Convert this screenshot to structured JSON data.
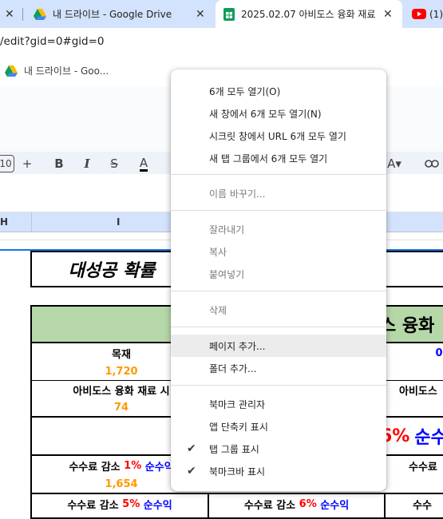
{
  "browser": {
    "tabs": [
      {
        "title": ""
      },
      {
        "title": "내 드라이브 - Google Drive"
      },
      {
        "title": "2025.02.07 아비도스 융화 재료"
      },
      {
        "title": "(1)"
      }
    ],
    "url": "/edit?gid=0#gid=0",
    "bookmark_label": "내 드라이브 - Goo..."
  },
  "sheet": {
    "font_size": "10",
    "columns": [
      "H",
      "I"
    ],
    "title": "대성공 확률",
    "right_header_partial": "스 융화",
    "rows": {
      "r1_left": "목재",
      "r1_right": "0",
      "r2_left": "1,720",
      "r3_left": "아비도스 융화 재료 시",
      "r3_right": "아비도스",
      "r4_left": "74",
      "r5_right_pct": "6%",
      "r5_right_text": "순수",
      "r6_left_prefix": "수수료 감소",
      "r6_left_pct": "1%",
      "r6_left_suffix": "순수익",
      "r6_right": "수수료",
      "r7_left": "1,654",
      "r8_c1_prefix": "수수료 감소",
      "r8_c1_pct": "5%",
      "r8_c1_suffix": "순수익",
      "r8_c2_prefix": "수수료 감소",
      "r8_c2_pct": "6%",
      "r8_c2_suffix": "순수익",
      "r8_c3": "수수"
    }
  },
  "context_menu": {
    "groups": [
      [
        "6개 모두 열기(O)",
        "새 창에서 6개 모두 열기(N)",
        "시크릿 창에서 URL 6개 모두 열기",
        "새 탭 그룹에서 6개 모두 열기"
      ],
      [
        "이름 바꾸기..."
      ],
      [
        "잘라내기",
        "복사",
        "붙여넣기"
      ],
      [
        "삭제"
      ],
      [
        "페이지 추가...",
        "폴더 추가..."
      ],
      [
        "북마크 관리자",
        "앱 단축키 표시",
        "탭 그룹 표시",
        "북마크바 표시"
      ]
    ]
  },
  "colors": {
    "tabstrip": "#d3e3fd",
    "accent_blue": "#1a73e8",
    "sheet_green_header": "#b6d7a8",
    "orange_value": "#ff9900",
    "red_text": "#ff0000",
    "blue_text": "#0000ff"
  }
}
